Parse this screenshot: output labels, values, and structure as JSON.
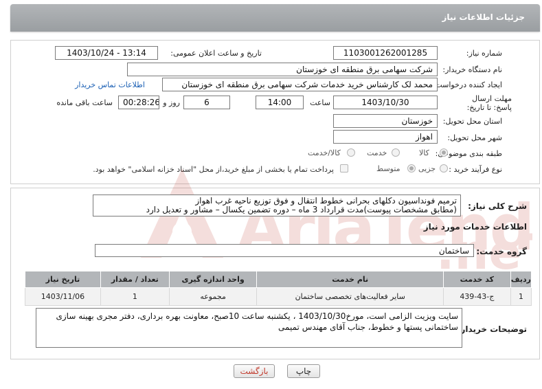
{
  "header": {
    "title": "جزئیات اطلاعات نیاز"
  },
  "fields": {
    "need_number_label": "شماره نیاز:",
    "need_number": "1103001262001285",
    "announce_label": "تاریخ و ساعت اعلان عمومی:",
    "announce_value": "1403/10/24 - 13:14",
    "buyer_org_label": "نام دستگاه خریدار:",
    "buyer_org": "شرکت سهامی برق منطقه ای خوزستان",
    "creator_label": "ایجاد کننده درخواست:",
    "creator": "محمد لک کارشناس خرید خدمات شرکت سهامی برق منطقه ای خوزستان",
    "contact_link": "اطلاعات تماس خریدار",
    "deadline_label": "مهلت ارسال پاسخ: تا تاریخ:",
    "deadline_date": "1403/10/30",
    "time_label": "ساعت",
    "deadline_time": "14:00",
    "days_value": "6",
    "days_label": "روز و",
    "remaining_time": "00:28:26",
    "remaining_label": "ساعت باقی مانده",
    "province_label": "استان محل تحویل:",
    "province": "خوزستان",
    "city_label": "شهر محل تحویل:",
    "city": "اهواز",
    "category_label": "طبقه بندی موضوعی:",
    "category_options": [
      "کالا",
      "خدمت",
      "کالا/خدمت"
    ],
    "process_label": "نوع فرآیند خرید :",
    "process_options": [
      "جزیی",
      "متوسط"
    ],
    "payment_note": "پرداخت تمام یا بخشی از مبلغ خرید،از محل \"اسناد خزانه اسلامی\" خواهد بود."
  },
  "description": {
    "label": "شرح کلی نیاز:",
    "line1": "ترمیم فونداسیون دکلهای بحرانی خطوط انتقال و فوق توزیع ناحیه غرب اهواز",
    "line2": "(مطابق مشخصات پیوست)مدت قرارداد 3 ماه – دوره تضمین یکسال – مشاور و تعدیل دارد"
  },
  "services": {
    "section_title": "اطلاعات خدمات مورد نیاز",
    "group_label": "گروه خدمت:",
    "group_value": "ساختمان",
    "columns": [
      "ردیف",
      "کد خدمت",
      "نام خدمت",
      "واحد اندازه گیری",
      "تعداد / مقدار",
      "تاریخ نیاز"
    ],
    "rows": [
      [
        "1",
        "ج-43-439",
        "سایر فعالیت‌های تخصصی ساختمان",
        "مجموعه",
        "1",
        "1403/11/06"
      ]
    ]
  },
  "buyer_notes": {
    "label": "توضیحات خریدار:",
    "line1": "سایت ویزیت الزامی است، مورخ1403/10/30 ، یکشنبه  ساعت 10صبح، معاونت بهره برداری، دفتر مجری بهینه سازی",
    "line2": "ساختمانی پستها و خطوط، جناب آقای مهندس تمیمی"
  },
  "buttons": {
    "print": "چاپ",
    "back": "بازگشت"
  },
  "watermark": "AriaTender.net",
  "colors": {
    "header_bg": "#a5a9ac",
    "link": "#1a5fb4",
    "back_text": "#c0392b",
    "watermark": "#c0392b"
  }
}
